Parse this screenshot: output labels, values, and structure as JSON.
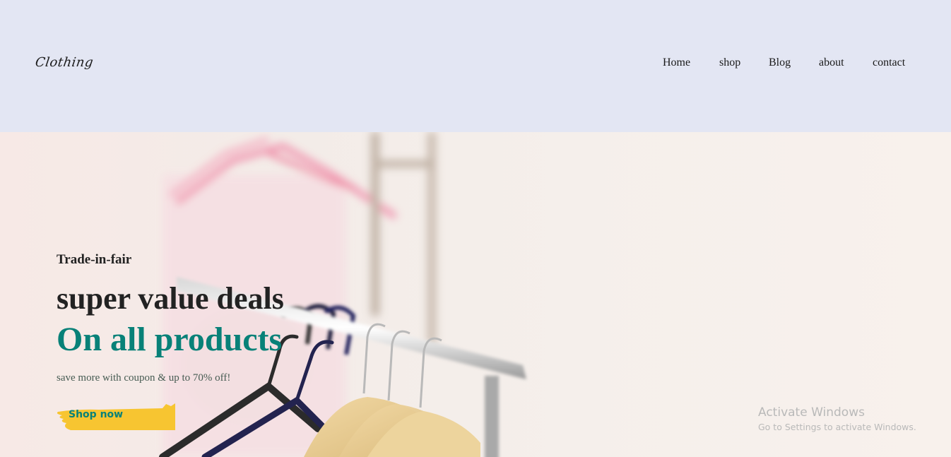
{
  "header": {
    "logo": "Clothing",
    "nav": [
      {
        "label": "Home"
      },
      {
        "label": "shop"
      },
      {
        "label": "Blog"
      },
      {
        "label": "about"
      },
      {
        "label": "contact"
      }
    ]
  },
  "hero": {
    "tag": "Trade-in-fair",
    "headline": "super value deals",
    "subheadline": "On all products",
    "description": "save more with coupon & up to 70% off!",
    "button_label": "Shop now",
    "image": "clothing-rack-hangers"
  },
  "watermark": {
    "title": "Activate Windows",
    "subtitle": "Go to Settings to activate Windows."
  },
  "colors": {
    "header_bg": "#e3e6f3",
    "accent": "#088178",
    "button_brush": "#f7c531",
    "text_dark": "#222222"
  }
}
